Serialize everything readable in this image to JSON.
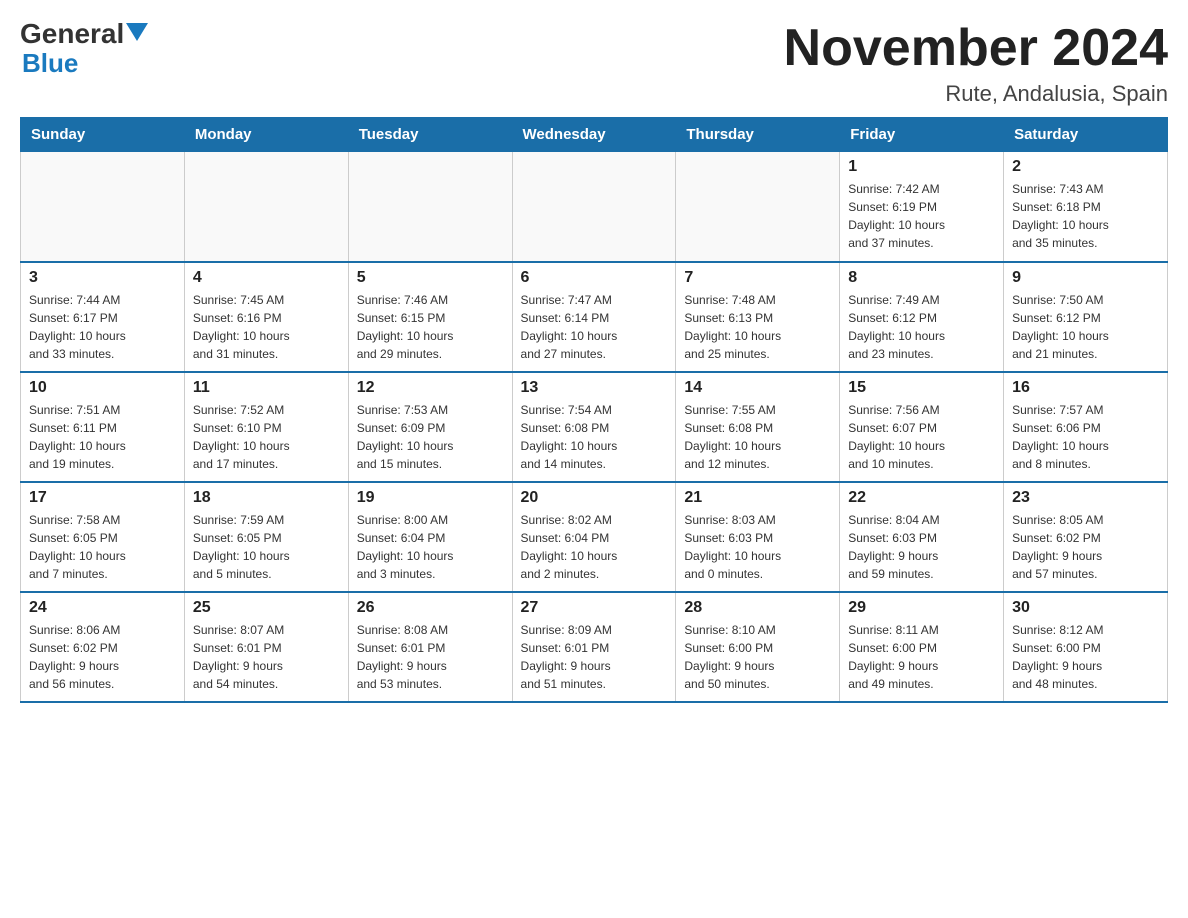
{
  "header": {
    "logo_general": "General",
    "logo_blue": "Blue",
    "main_title": "November 2024",
    "subtitle": "Rute, Andalusia, Spain"
  },
  "weekdays": [
    "Sunday",
    "Monday",
    "Tuesday",
    "Wednesday",
    "Thursday",
    "Friday",
    "Saturday"
  ],
  "weeks": [
    [
      {
        "day": "",
        "info": ""
      },
      {
        "day": "",
        "info": ""
      },
      {
        "day": "",
        "info": ""
      },
      {
        "day": "",
        "info": ""
      },
      {
        "day": "",
        "info": ""
      },
      {
        "day": "1",
        "info": "Sunrise: 7:42 AM\nSunset: 6:19 PM\nDaylight: 10 hours\nand 37 minutes."
      },
      {
        "day": "2",
        "info": "Sunrise: 7:43 AM\nSunset: 6:18 PM\nDaylight: 10 hours\nand 35 minutes."
      }
    ],
    [
      {
        "day": "3",
        "info": "Sunrise: 7:44 AM\nSunset: 6:17 PM\nDaylight: 10 hours\nand 33 minutes."
      },
      {
        "day": "4",
        "info": "Sunrise: 7:45 AM\nSunset: 6:16 PM\nDaylight: 10 hours\nand 31 minutes."
      },
      {
        "day": "5",
        "info": "Sunrise: 7:46 AM\nSunset: 6:15 PM\nDaylight: 10 hours\nand 29 minutes."
      },
      {
        "day": "6",
        "info": "Sunrise: 7:47 AM\nSunset: 6:14 PM\nDaylight: 10 hours\nand 27 minutes."
      },
      {
        "day": "7",
        "info": "Sunrise: 7:48 AM\nSunset: 6:13 PM\nDaylight: 10 hours\nand 25 minutes."
      },
      {
        "day": "8",
        "info": "Sunrise: 7:49 AM\nSunset: 6:12 PM\nDaylight: 10 hours\nand 23 minutes."
      },
      {
        "day": "9",
        "info": "Sunrise: 7:50 AM\nSunset: 6:12 PM\nDaylight: 10 hours\nand 21 minutes."
      }
    ],
    [
      {
        "day": "10",
        "info": "Sunrise: 7:51 AM\nSunset: 6:11 PM\nDaylight: 10 hours\nand 19 minutes."
      },
      {
        "day": "11",
        "info": "Sunrise: 7:52 AM\nSunset: 6:10 PM\nDaylight: 10 hours\nand 17 minutes."
      },
      {
        "day": "12",
        "info": "Sunrise: 7:53 AM\nSunset: 6:09 PM\nDaylight: 10 hours\nand 15 minutes."
      },
      {
        "day": "13",
        "info": "Sunrise: 7:54 AM\nSunset: 6:08 PM\nDaylight: 10 hours\nand 14 minutes."
      },
      {
        "day": "14",
        "info": "Sunrise: 7:55 AM\nSunset: 6:08 PM\nDaylight: 10 hours\nand 12 minutes."
      },
      {
        "day": "15",
        "info": "Sunrise: 7:56 AM\nSunset: 6:07 PM\nDaylight: 10 hours\nand 10 minutes."
      },
      {
        "day": "16",
        "info": "Sunrise: 7:57 AM\nSunset: 6:06 PM\nDaylight: 10 hours\nand 8 minutes."
      }
    ],
    [
      {
        "day": "17",
        "info": "Sunrise: 7:58 AM\nSunset: 6:05 PM\nDaylight: 10 hours\nand 7 minutes."
      },
      {
        "day": "18",
        "info": "Sunrise: 7:59 AM\nSunset: 6:05 PM\nDaylight: 10 hours\nand 5 minutes."
      },
      {
        "day": "19",
        "info": "Sunrise: 8:00 AM\nSunset: 6:04 PM\nDaylight: 10 hours\nand 3 minutes."
      },
      {
        "day": "20",
        "info": "Sunrise: 8:02 AM\nSunset: 6:04 PM\nDaylight: 10 hours\nand 2 minutes."
      },
      {
        "day": "21",
        "info": "Sunrise: 8:03 AM\nSunset: 6:03 PM\nDaylight: 10 hours\nand 0 minutes."
      },
      {
        "day": "22",
        "info": "Sunrise: 8:04 AM\nSunset: 6:03 PM\nDaylight: 9 hours\nand 59 minutes."
      },
      {
        "day": "23",
        "info": "Sunrise: 8:05 AM\nSunset: 6:02 PM\nDaylight: 9 hours\nand 57 minutes."
      }
    ],
    [
      {
        "day": "24",
        "info": "Sunrise: 8:06 AM\nSunset: 6:02 PM\nDaylight: 9 hours\nand 56 minutes."
      },
      {
        "day": "25",
        "info": "Sunrise: 8:07 AM\nSunset: 6:01 PM\nDaylight: 9 hours\nand 54 minutes."
      },
      {
        "day": "26",
        "info": "Sunrise: 8:08 AM\nSunset: 6:01 PM\nDaylight: 9 hours\nand 53 minutes."
      },
      {
        "day": "27",
        "info": "Sunrise: 8:09 AM\nSunset: 6:01 PM\nDaylight: 9 hours\nand 51 minutes."
      },
      {
        "day": "28",
        "info": "Sunrise: 8:10 AM\nSunset: 6:00 PM\nDaylight: 9 hours\nand 50 minutes."
      },
      {
        "day": "29",
        "info": "Sunrise: 8:11 AM\nSunset: 6:00 PM\nDaylight: 9 hours\nand 49 minutes."
      },
      {
        "day": "30",
        "info": "Sunrise: 8:12 AM\nSunset: 6:00 PM\nDaylight: 9 hours\nand 48 minutes."
      }
    ]
  ]
}
